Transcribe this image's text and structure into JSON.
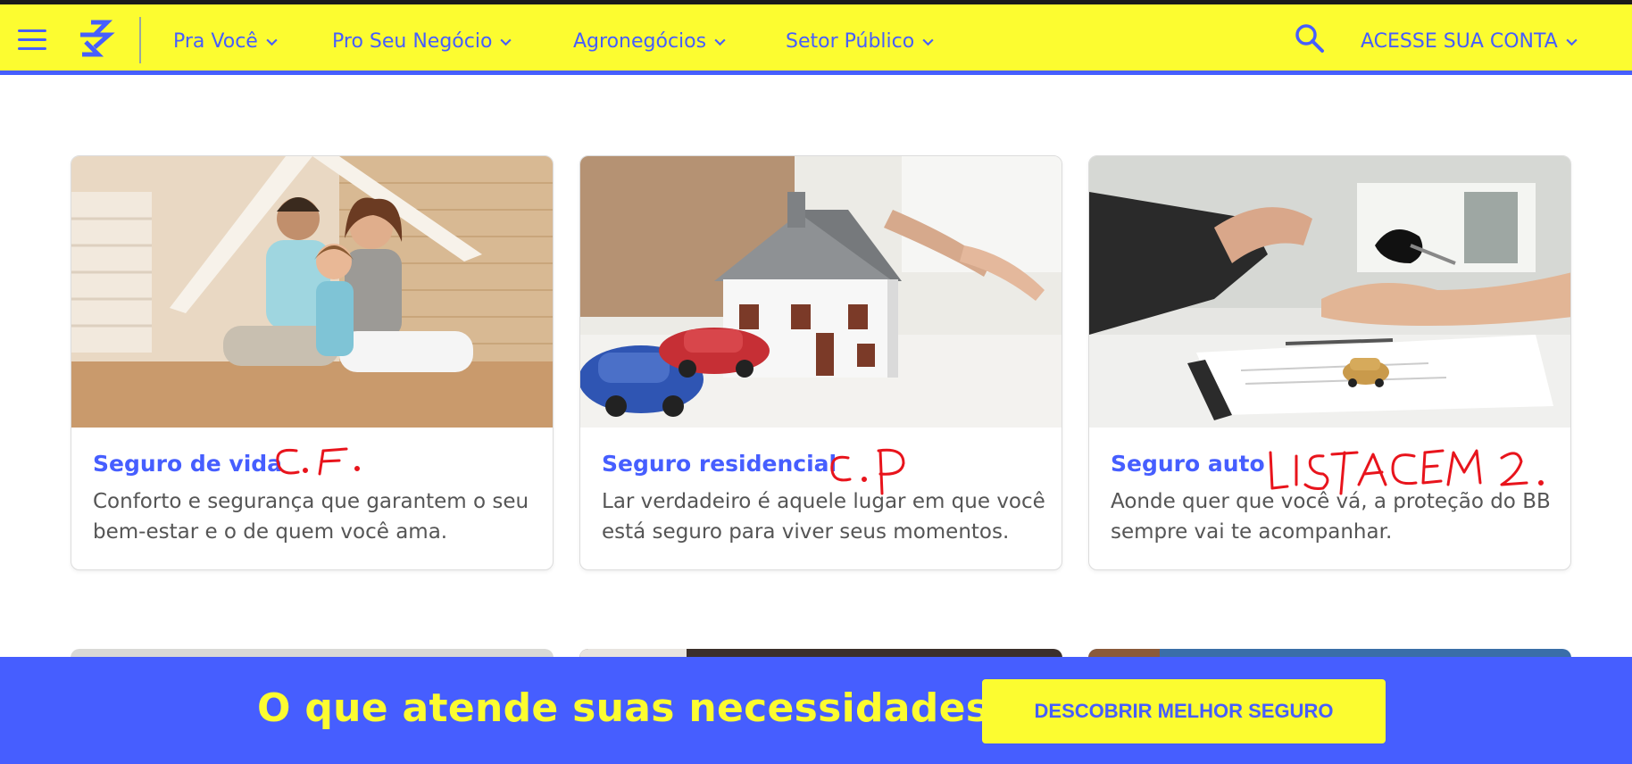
{
  "nav": {
    "items": [
      {
        "label": "Pra Você"
      },
      {
        "label": "Pro Seu Negócio"
      },
      {
        "label": "Agronegócios"
      },
      {
        "label": "Setor Público"
      }
    ],
    "account_label": "ACESSE SUA CONTA"
  },
  "cards": [
    {
      "title": "Seguro de vida",
      "description": "Conforto e segurança que garantem o seu bem-estar e o de quem você ama.",
      "annotation": "C.F."
    },
    {
      "title": "Seguro residencial",
      "description": "Lar verdadeiro é aquele lugar em que você está seguro para viver seus momentos.",
      "annotation": "C.P"
    },
    {
      "title": "Seguro auto",
      "description": "Aonde quer que você vá, a proteção do BB sempre vai te acompanhar.",
      "annotation": "LISTAGEM 2."
    }
  ],
  "footer_banner": {
    "headline": "O que atende suas necessidades?",
    "button_label": "DESCOBRIR MELHOR SEGURO"
  },
  "colors": {
    "brand_yellow": "#fcfc30",
    "brand_blue": "#465eff",
    "handwriting_red": "#e8141c"
  },
  "icons": [
    "menu-icon",
    "bb-logo-icon",
    "chevron-down-icon",
    "search-icon"
  ]
}
